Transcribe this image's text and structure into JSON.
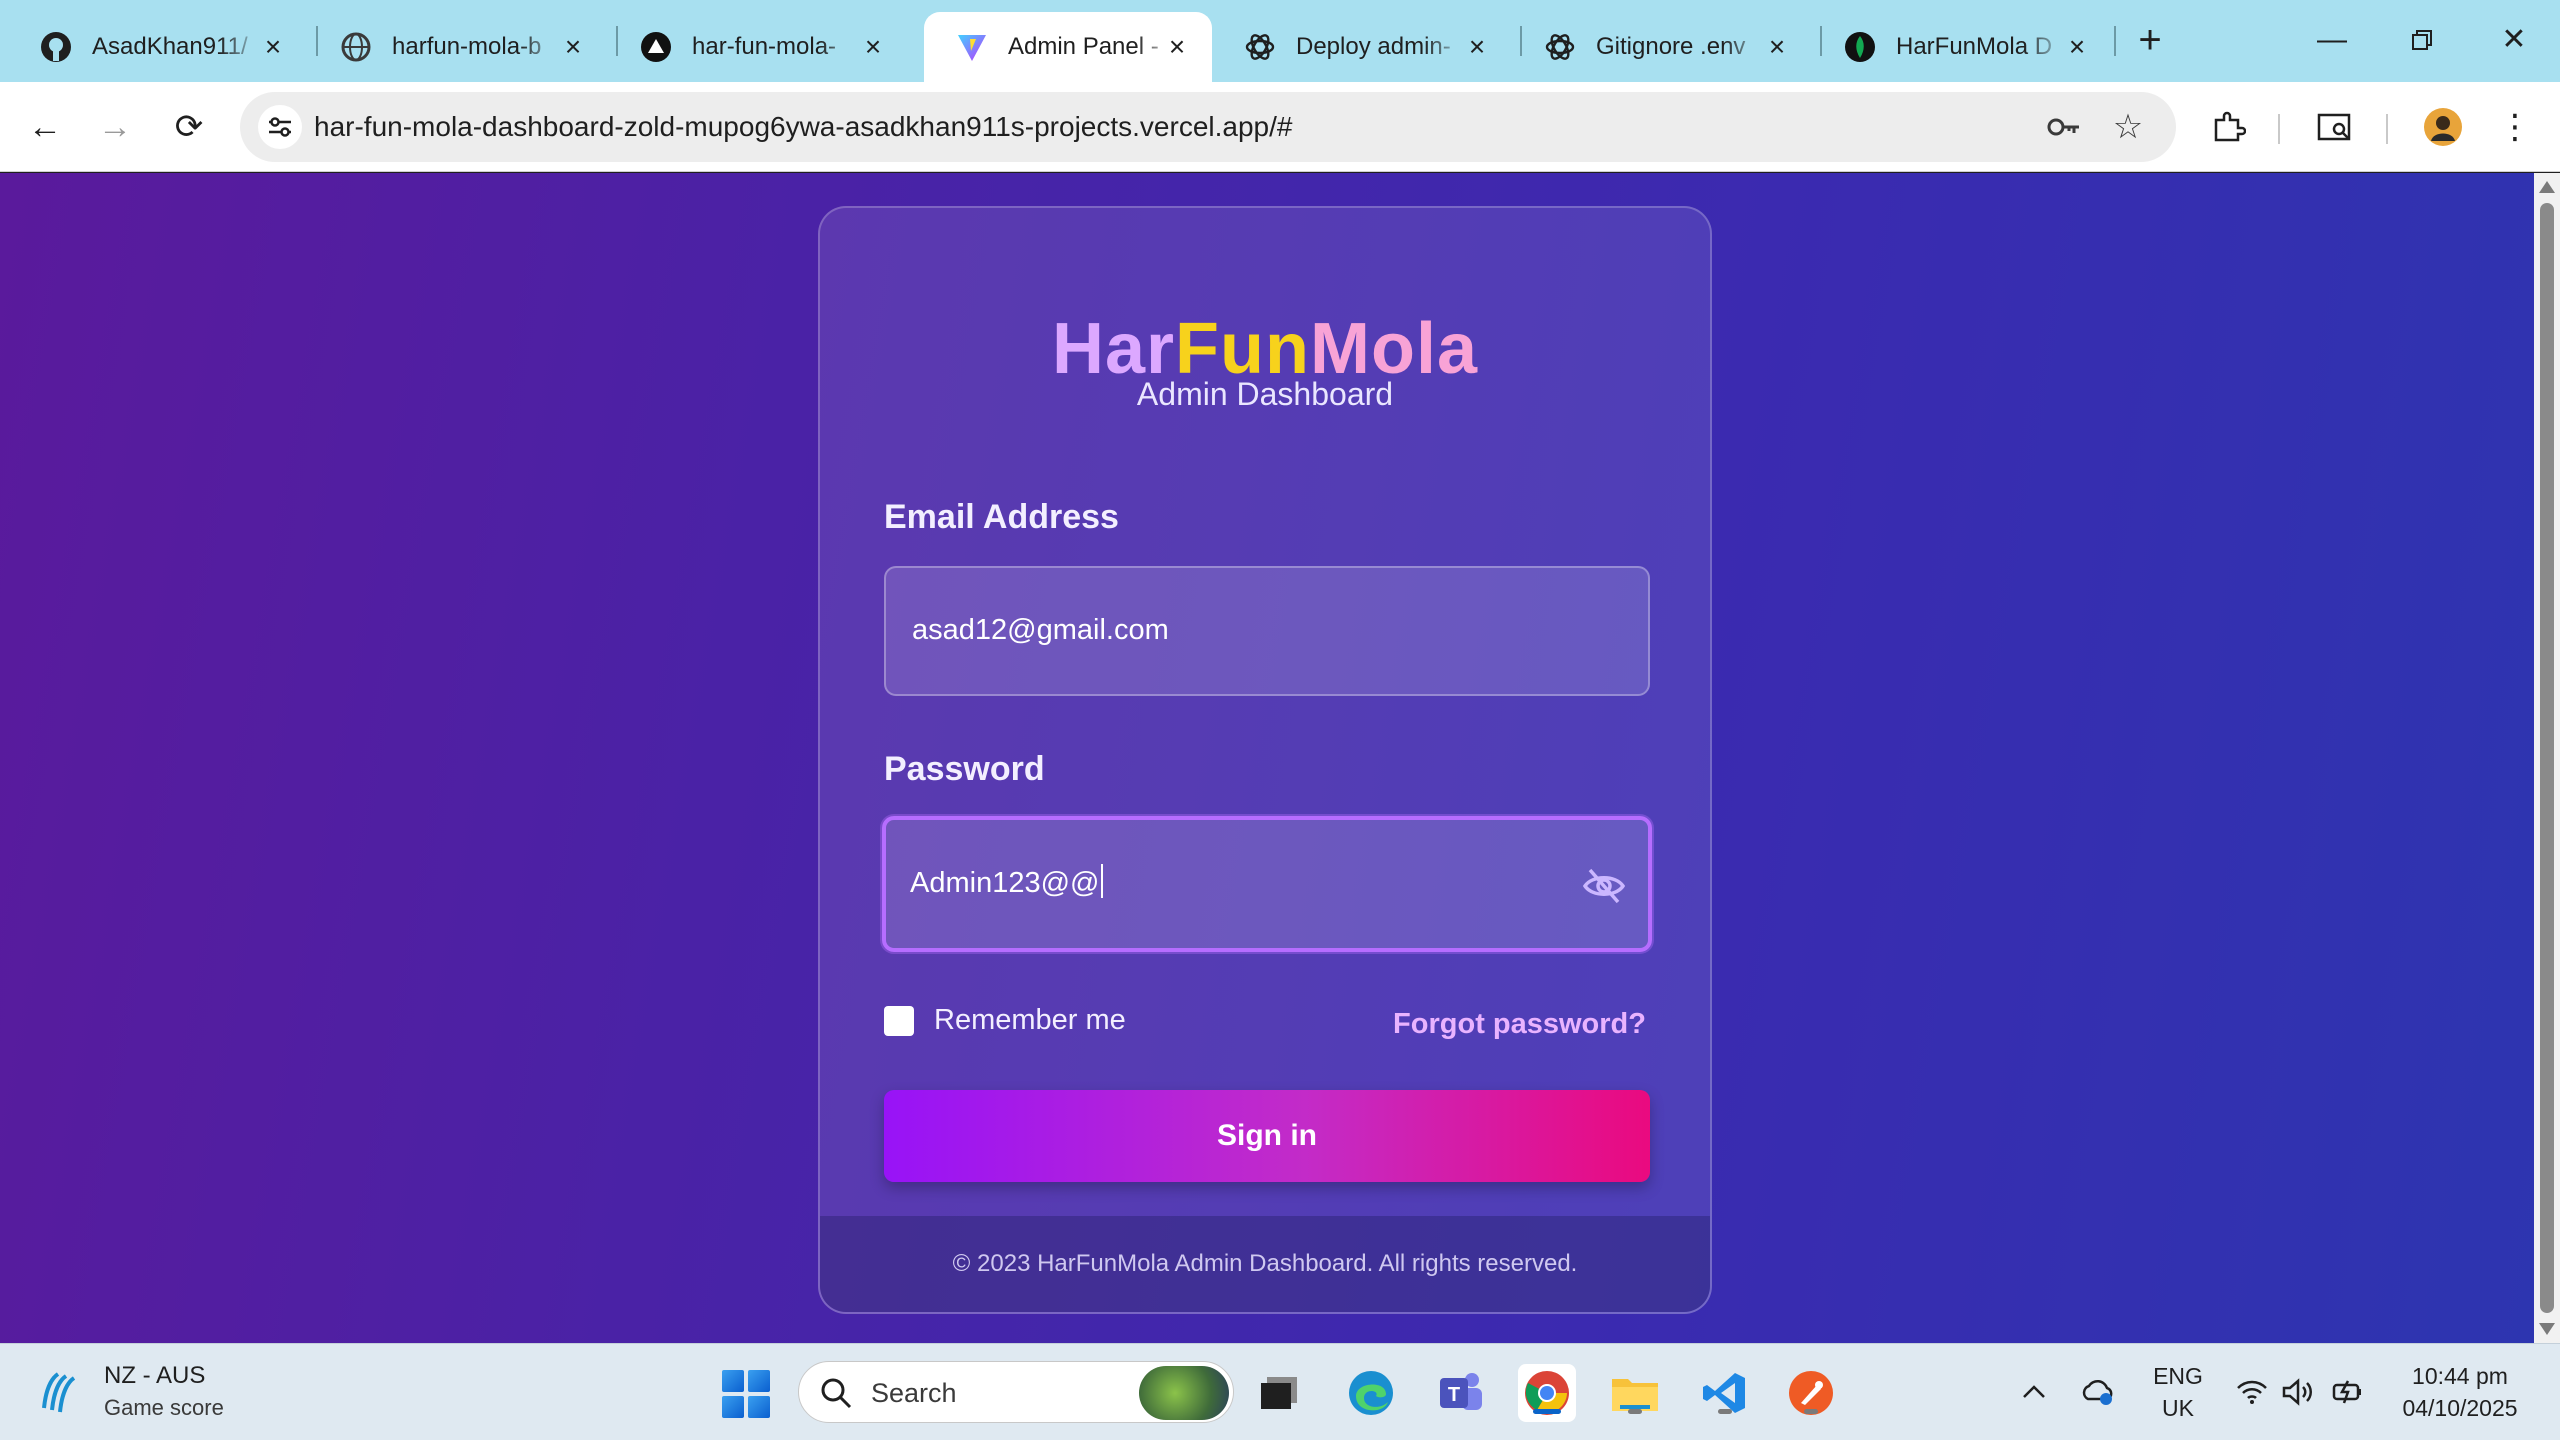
{
  "browser": {
    "tabs": [
      {
        "title": "AsadKhan911/",
        "icon": "github-icon"
      },
      {
        "title": "harfun-mola-b",
        "icon": "globe-icon"
      },
      {
        "title": "har-fun-mola-",
        "icon": "vercel-icon"
      },
      {
        "title": "Admin Panel -",
        "icon": "vite-icon",
        "active": true
      },
      {
        "title": "Deploy admin-",
        "icon": "chatgpt-icon"
      },
      {
        "title": "Gitignore .env",
        "icon": "chatgpt-icon"
      },
      {
        "title": "HarFunMola D",
        "icon": "mongodb-icon"
      }
    ],
    "url": "har-fun-mola-dashboard-zold-mupog6ywa-asadkhan911s-projects.vercel.app/#"
  },
  "login": {
    "brand": {
      "part1": "Har",
      "part2": "Fun",
      "part3": "Mola"
    },
    "subtitle": "Admin Dashboard",
    "email_label": "Email Address",
    "email_value": "asad12@gmail.com",
    "password_label": "Password",
    "password_value": "Admin123@@",
    "remember_label": "Remember me",
    "remember_checked": false,
    "forgot_label": "Forgot password?",
    "signin_label": "Sign in",
    "footer": "© 2023 HarFunMola Admin Dashboard. All rights reserved."
  },
  "taskbar": {
    "weather_title": "NZ - AUS",
    "weather_sub": "Game score",
    "search_placeholder": "Search",
    "lang_top": "ENG",
    "lang_bottom": "UK",
    "time": "10:44 pm",
    "date": "04/10/2025"
  },
  "colors": {
    "accent_purple": "#9813f7",
    "accent_pink": "#ea0a7f",
    "brand_yellow": "#f7d21c",
    "tab_strip": "#a8e0f0"
  }
}
